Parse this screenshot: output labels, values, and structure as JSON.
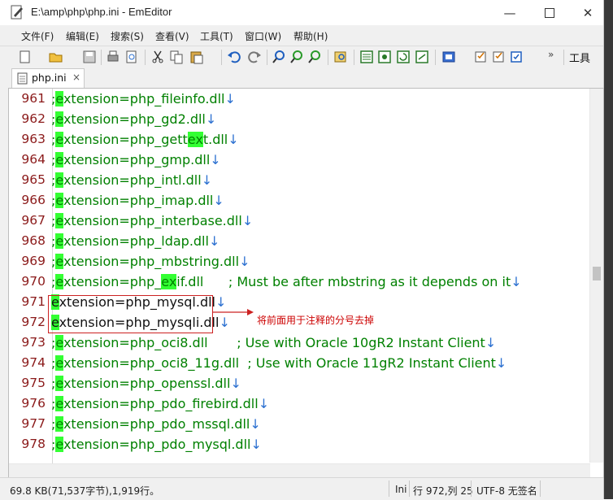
{
  "window": {
    "title": "E:\\amp\\php\\php.ini - EmEditor"
  },
  "menu": [
    "文件(F)",
    "编辑(E)",
    "搜索(S)",
    "查看(V)",
    "工具(T)",
    "窗口(W)",
    "帮助(H)"
  ],
  "toolbar": {
    "overflow_label": "工具"
  },
  "tab": {
    "label": "php.ini",
    "close": "×"
  },
  "lines": [
    {
      "num": "961",
      "pre": "",
      "hl": "",
      "post": "xtension=php_fileinfo.dll"
    },
    {
      "num": "962",
      "pre": "",
      "hl": "",
      "post": "xtension=php_gd2.dll"
    },
    {
      "num": "963",
      "pre": "",
      "hl": "ex",
      "post": ""
    },
    {
      "num": "964",
      "pre": "",
      "hl": "",
      "post": "xtension=php_gmp.dll"
    },
    {
      "num": "965",
      "pre": "",
      "hl": "",
      "post": "xtension=php_intl.dll"
    },
    {
      "num": "966",
      "pre": "",
      "hl": "",
      "post": "xtension=php_imap.dll"
    },
    {
      "num": "967",
      "pre": "",
      "hl": "",
      "post": "xtension=php_interbase.dll"
    },
    {
      "num": "968",
      "pre": "",
      "hl": "",
      "post": "xtension=php_ldap.dll"
    },
    {
      "num": "969",
      "pre": "",
      "hl": "",
      "post": "xtension=php_mbstring.dll"
    },
    {
      "num": "970",
      "pre": "",
      "hl": "ex",
      "post": ""
    },
    {
      "num": "971",
      "pre": "",
      "hl": "",
      "post": "xtension=php_mysql.dll"
    },
    {
      "num": "972",
      "pre": "",
      "hl": "",
      "post": "xtension=php_mysqli.dll"
    },
    {
      "num": "973",
      "pre": "",
      "hl": "",
      "post": "xtension=php_oci8.dll       ; Use with Oracle 10gR2 Instant Client"
    },
    {
      "num": "974",
      "pre": "",
      "hl": "",
      "post": "xtension=php_oci8_11g.dll  ; Use with Oracle 11gR2 Instant Client"
    },
    {
      "num": "975",
      "pre": "",
      "hl": "",
      "post": "xtension=php_openssl.dll"
    },
    {
      "num": "976",
      "pre": "",
      "hl": "",
      "post": "xtension=php_pdo_firebird.dll"
    },
    {
      "num": "977",
      "pre": "",
      "hl": "",
      "post": "xtension=php_pdo_mssql.dll"
    },
    {
      "num": "978",
      "pre": "",
      "hl": "",
      "post": "xtension=php_pdo_mysql.dll"
    }
  ],
  "line963": {
    "a": ";",
    "b": "extension=php_gett",
    "c": "ex",
    "d": "t.dll"
  },
  "line970": {
    "a": ";",
    "b": "extension=php_",
    "c": "ex",
    "d": "if.dll      ; Must be after mbstring as it depends on it"
  },
  "eol_mark": "↓",
  "annotation": "将前面用于注释的分号去掉",
  "status": {
    "size": "69.8 KB(71,537字节),1,919行。",
    "mode": "Ini",
    "position": "行 972,列 25",
    "encoding": "UTF-8 无签名"
  }
}
